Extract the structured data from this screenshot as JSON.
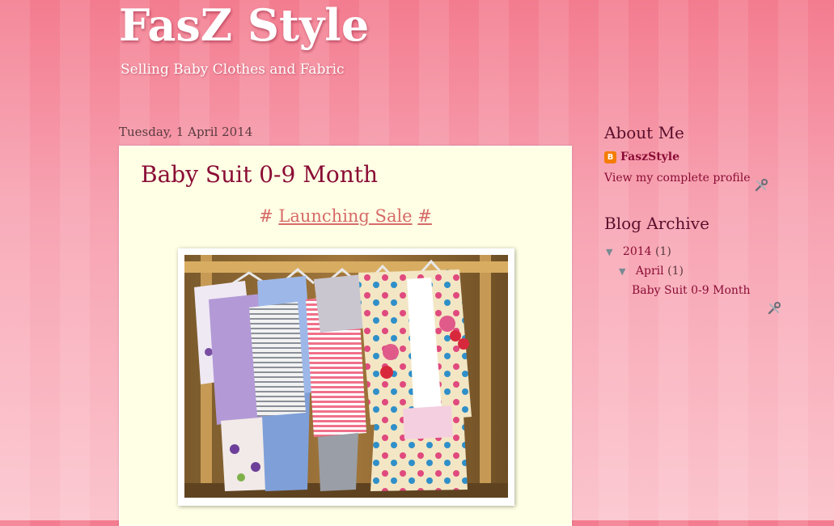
{
  "header": {
    "title": "FasZ Style",
    "description": "Selling Baby Clothes and Fabric"
  },
  "post": {
    "date": "Tuesday, 1 April 2014",
    "title": "Baby Suit 0-9 Month",
    "hash_left": "#",
    "launch_link": "Launching Sale",
    "hash_right": "#"
  },
  "sidebar": {
    "about": {
      "title": "About Me",
      "blogger_icon_letter": "B",
      "profile_name": "FaszStyle",
      "profile_link": "View my complete profile"
    },
    "archive": {
      "title": "Blog Archive",
      "year": {
        "toggle": "▼",
        "label": "2014",
        "count": "(1)"
      },
      "month": {
        "toggle": "▼",
        "label": "April",
        "count": "(1)"
      },
      "post": "Baby Suit 0-9 Month"
    }
  },
  "colors": {
    "accent": "#8a0c35",
    "post_bg": "#ffffe5",
    "link_coral": "#d66a68"
  }
}
